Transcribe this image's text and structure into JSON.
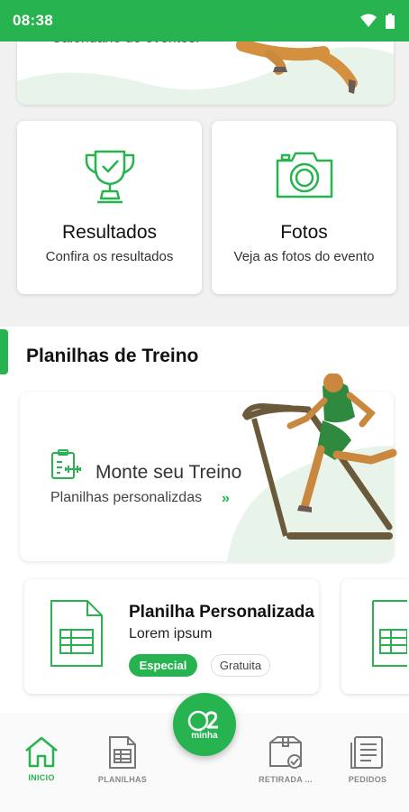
{
  "status_bar": {
    "time": "08:38"
  },
  "top_card": {
    "text": "Calendário de eventos."
  },
  "cards": [
    {
      "title": "Resultados",
      "subtitle": "Confira os resultados",
      "icon": "trophy-icon"
    },
    {
      "title": "Fotos",
      "subtitle": "Veja as fotos do evento",
      "icon": "camera-icon"
    }
  ],
  "section": {
    "title": "Planilhas de Treino"
  },
  "banner": {
    "title": "Monte seu Treino",
    "subtitle": "Planilhas personalizdas",
    "arrow": "»"
  },
  "plan_card": {
    "title": "Planilha Personalizada",
    "subtitle": "Lorem ipsum",
    "tag_special": "Especial",
    "tag_free": "Gratuita"
  },
  "fab": {
    "label": "minha"
  },
  "bottom_nav": [
    {
      "label": "INICIO",
      "icon": "home-icon",
      "active": true
    },
    {
      "label": "PLANILHAS",
      "icon": "spreadsheet-icon",
      "active": false
    },
    {
      "label": "RETIRADA ...",
      "icon": "package-icon",
      "active": false
    },
    {
      "label": "PEDIDOS",
      "icon": "orders-icon",
      "active": false
    }
  ],
  "colors": {
    "accent": "#27b34f",
    "background": "#f1f1f1"
  }
}
